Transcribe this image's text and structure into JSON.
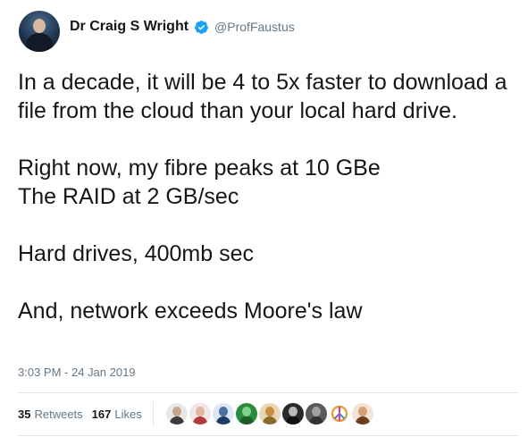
{
  "author": {
    "display_name": "Dr Craig S Wright",
    "handle": "@ProfFaustus",
    "verified_icon": "verified-badge-icon",
    "verified_color": "#1da1f2"
  },
  "tweet": {
    "text": "In a decade, it will be 4 to 5x faster to download a file from the cloud than your local hard drive.\n\nRight now, my fibre peaks at 10 GBe\nThe RAID at 2 GB/sec\n\nHard drives, 400mb sec\n\nAnd, network exceeds Moore's law",
    "timestamp": "3:03 PM - 24 Jan 2019"
  },
  "stats": {
    "retweets_count": "35",
    "retweets_label": "Retweets",
    "likes_count": "167",
    "likes_label": "Likes"
  },
  "likers": [
    {
      "icon": "liker-avatar-icon",
      "bg": "#e9e9e9",
      "face": "#c7a48a",
      "torso": "#3b3b3b"
    },
    {
      "icon": "liker-avatar-icon",
      "bg": "#f0e6e6",
      "face": "#e2b6a0",
      "torso": "#b33a3a"
    },
    {
      "icon": "liker-avatar-icon",
      "bg": "#dfe7f2",
      "face": "#4a6fa5",
      "torso": "#1f3b66"
    },
    {
      "icon": "liker-avatar-icon",
      "bg": "#2e8b3d",
      "face": "#7fd18a",
      "torso": "#1d5c27"
    },
    {
      "icon": "liker-avatar-icon",
      "bg": "#e8d8b5",
      "face": "#c98f3d",
      "torso": "#8a6a2a"
    },
    {
      "icon": "liker-avatar-icon",
      "bg": "#2a2a2a",
      "face": "#b8b8b8",
      "torso": "#111111"
    },
    {
      "icon": "liker-avatar-icon",
      "bg": "#5a5a5a",
      "face": "#a0a0a0",
      "torso": "#333333"
    },
    {
      "icon": "liker-avatar-icon",
      "bg": "#ffffff",
      "face": "#ffffff",
      "torso": "#ffffff",
      "peace": true
    },
    {
      "icon": "liker-avatar-icon",
      "bg": "#f2e4d6",
      "face": "#d9a074",
      "torso": "#6b3e1f"
    }
  ]
}
